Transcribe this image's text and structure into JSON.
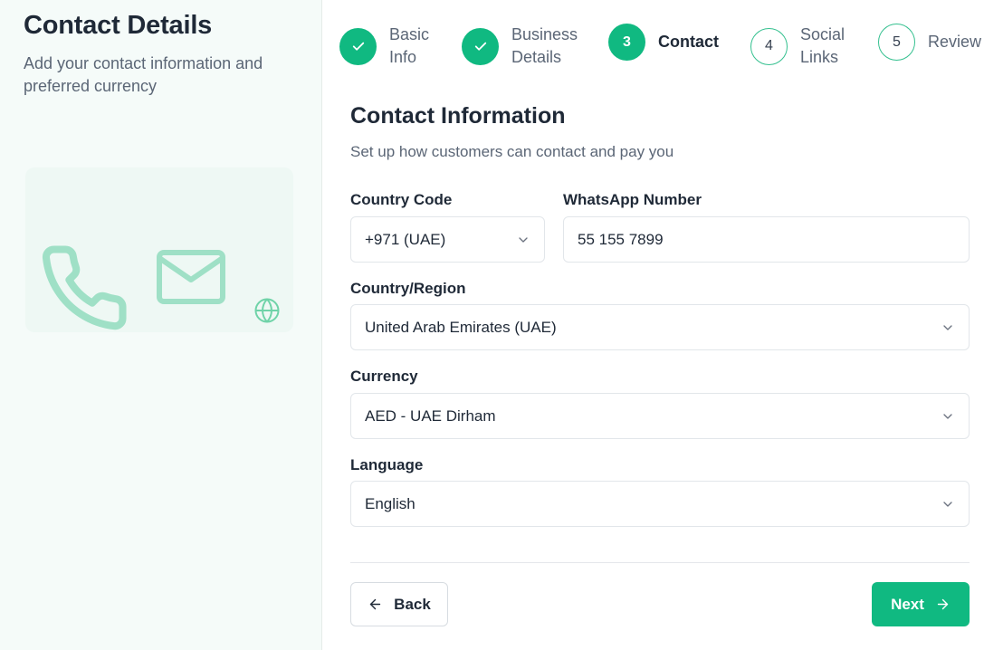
{
  "sidebar": {
    "title": "Contact Details",
    "subtitle": "Add your contact information and preferred currency",
    "illustration_icons": [
      "phone-icon",
      "mail-icon",
      "globe-icon"
    ]
  },
  "stepper": {
    "steps": [
      {
        "number": "1",
        "label_line1": "Basic",
        "label_line2": "Info",
        "status": "completed"
      },
      {
        "number": "2",
        "label_line1": "Business",
        "label_line2": "Details",
        "status": "completed"
      },
      {
        "number": "3",
        "label_line1": "Contact",
        "label_line2": "",
        "status": "active"
      },
      {
        "number": "4",
        "label_line1": "Social",
        "label_line2": "Links",
        "status": "pending"
      },
      {
        "number": "5",
        "label_line1": "Review",
        "label_line2": "",
        "status": "pending"
      }
    ]
  },
  "form": {
    "title": "Contact Information",
    "subtitle": "Set up how customers can contact and pay you",
    "country_code": {
      "label": "Country Code",
      "value": "+971 (UAE)"
    },
    "whatsapp": {
      "label": "WhatsApp Number",
      "value": "55 155 7899"
    },
    "country_region": {
      "label": "Country/Region",
      "value": "United Arab Emirates (UAE)"
    },
    "currency": {
      "label": "Currency",
      "value": "AED - UAE Dirham"
    },
    "language": {
      "label": "Language",
      "value": "English"
    }
  },
  "actions": {
    "back_label": "Back",
    "next_label": "Next"
  },
  "colors": {
    "accent": "#10b981",
    "sidebar_bg": "#f5fbf9",
    "illustration": "#a7e3cb"
  }
}
